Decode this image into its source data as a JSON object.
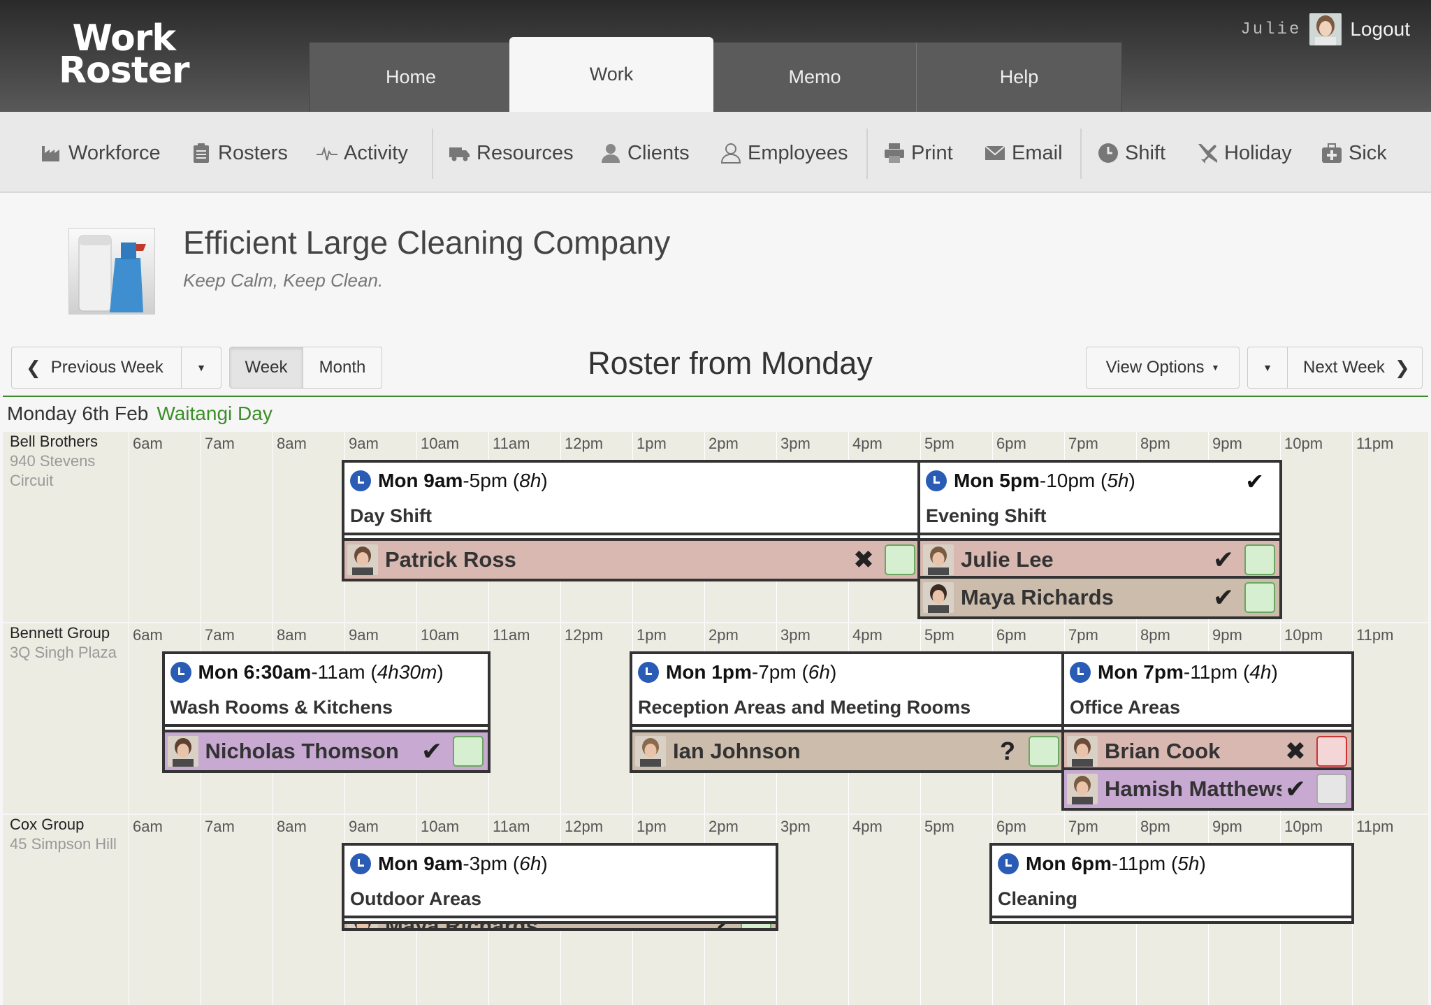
{
  "app": {
    "logo_line1": "Work",
    "logo_line2": "Roster"
  },
  "nav": {
    "tabs": [
      {
        "label": "Home",
        "active": false
      },
      {
        "label": "Work",
        "active": true
      },
      {
        "label": "Memo",
        "active": false
      },
      {
        "label": "Help",
        "active": false
      }
    ]
  },
  "user": {
    "name": "Julie",
    "logout": "Logout"
  },
  "toolbar": {
    "items": [
      {
        "label": "Workforce",
        "icon": "factory-icon"
      },
      {
        "label": "Rosters",
        "icon": "clipboard-icon"
      },
      {
        "label": "Activity",
        "icon": "pulse-icon"
      },
      {
        "label": "Resources",
        "icon": "truck-icon"
      },
      {
        "label": "Clients",
        "icon": "client-icon"
      },
      {
        "label": "Employees",
        "icon": "user-icon"
      },
      {
        "label": "Print",
        "icon": "printer-icon"
      },
      {
        "label": "Email",
        "icon": "envelope-icon"
      },
      {
        "label": "Shift",
        "icon": "clock-icon"
      },
      {
        "label": "Holiday",
        "icon": "plane-icon"
      },
      {
        "label": "Sick",
        "icon": "medkit-icon"
      }
    ]
  },
  "company": {
    "name": "Efficient Large Cleaning Company",
    "tagline": "Keep Calm, Keep Clean."
  },
  "controls": {
    "previous_week": "Previous Week",
    "week": "Week",
    "month": "Month",
    "title": "Roster from Monday",
    "view_options": "View Options",
    "next_week": "Next Week"
  },
  "day": {
    "label": "Monday 6th Feb",
    "holiday": "Waitangi Day"
  },
  "hours": [
    "6am",
    "7am",
    "8am",
    "9am",
    "10am",
    "11am",
    "12pm",
    "1pm",
    "2pm",
    "3pm",
    "4pm",
    "5pm",
    "6pm",
    "7pm",
    "8pm",
    "9pm",
    "10pm",
    "11pm"
  ],
  "colors": {
    "accent_green": "#3b8e28",
    "clock_blue": "#2a5bb5",
    "confirmed_pink": "#d8b8b1",
    "pending_tan": "#cbbcab",
    "purple": "#c7a9d2"
  },
  "clients": [
    {
      "name": "Bell Brothers",
      "address": "940 Stevens Circuit",
      "shifts": [
        {
          "day": "Mon",
          "start": "9am",
          "end": "5pm",
          "duration": "8h",
          "title": "Day Shift",
          "confirmed": false,
          "employees": [
            {
              "name": "Patrick Ross",
              "status": "✖",
              "box": "green",
              "color": "pink"
            }
          ]
        },
        {
          "day": "Mon",
          "start": "5pm",
          "end": "10pm",
          "duration": "5h",
          "title": "Evening Shift",
          "confirmed": true,
          "employees": [
            {
              "name": "Julie Lee",
              "status": "✔",
              "box": "green",
              "color": "pink"
            },
            {
              "name": "Maya Richards",
              "status": "✔",
              "box": "green",
              "color": "tan"
            }
          ]
        }
      ]
    },
    {
      "name": "Bennett Group",
      "address": "3Q Singh Plaza",
      "shifts": [
        {
          "day": "Mon",
          "start": "6:30am",
          "end": "11am",
          "duration": "4h30m",
          "title": "Wash Rooms & Kitchens",
          "employees": [
            {
              "name": "Nicholas Thomson",
              "status": "✔",
              "box": "green",
              "color": "purple"
            }
          ]
        },
        {
          "day": "Mon",
          "start": "1pm",
          "end": "7pm",
          "duration": "6h",
          "title": "Reception Areas and Meeting Rooms",
          "employees": [
            {
              "name": "Ian Johnson",
              "status": "?",
              "box": "green",
              "color": "tan"
            }
          ]
        },
        {
          "day": "Mon",
          "start": "7pm",
          "end": "11pm",
          "duration": "4h",
          "title": "Office Areas",
          "employees": [
            {
              "name": "Brian Cook",
              "status": "✖",
              "box": "red",
              "color": "pink"
            },
            {
              "name": "Hamish Matthews",
              "status": "✔",
              "box": "grey",
              "color": "purple"
            }
          ]
        }
      ]
    },
    {
      "name": "Cox Group",
      "address": "45 Simpson Hill",
      "shifts": [
        {
          "day": "Mon",
          "start": "9am",
          "end": "3pm",
          "duration": "6h",
          "title": "Outdoor Areas",
          "employees": [
            {
              "name": "Maya Richards",
              "status": "?",
              "box": "green",
              "color": "tan"
            }
          ]
        },
        {
          "day": "Mon",
          "start": "6pm",
          "end": "11pm",
          "duration": "5h",
          "title": "Cleaning",
          "employees": []
        }
      ]
    }
  ]
}
